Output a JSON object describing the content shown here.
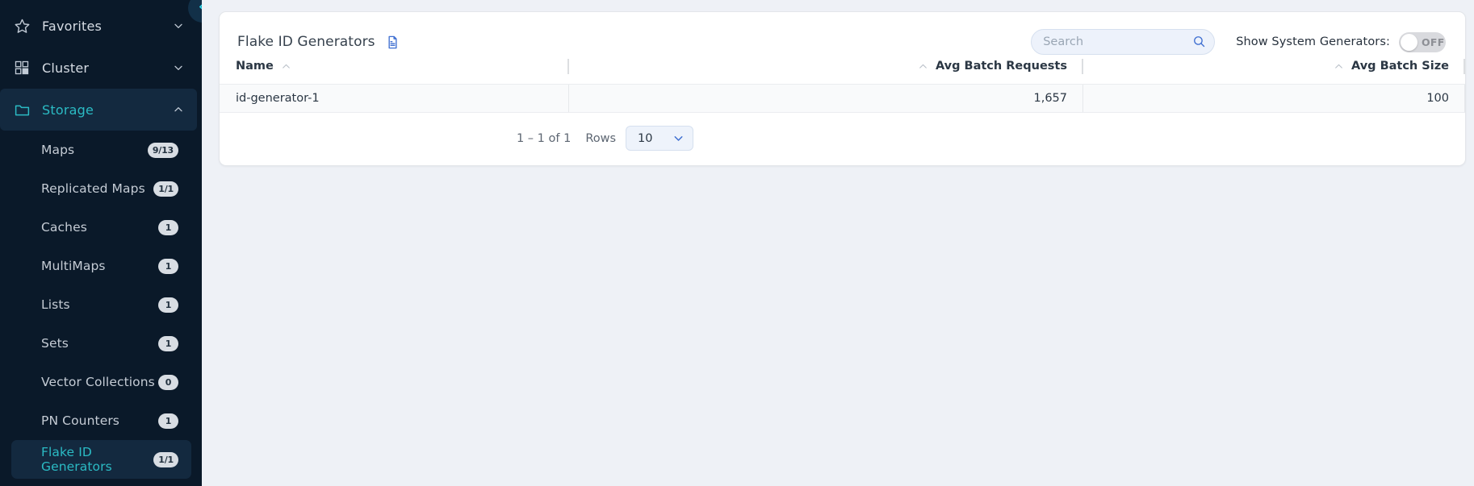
{
  "sidebar": {
    "collapse_icon": "double-chevron-left-icon",
    "groups": [
      {
        "label": "Favorites",
        "icon": "star-icon",
        "expanded": false,
        "chevron": "chevron-down-icon",
        "active": false
      },
      {
        "label": "Cluster",
        "icon": "grid-icon",
        "expanded": false,
        "chevron": "chevron-down-icon",
        "active": false
      },
      {
        "label": "Storage",
        "icon": "folder-icon",
        "expanded": true,
        "chevron": "chevron-up-icon",
        "active": true
      }
    ],
    "items": [
      {
        "label": "Maps",
        "badge": "9/13",
        "selected": false
      },
      {
        "label": "Replicated Maps",
        "badge": "1/1",
        "selected": false
      },
      {
        "label": "Caches",
        "badge": "1",
        "selected": false
      },
      {
        "label": "MultiMaps",
        "badge": "1",
        "selected": false
      },
      {
        "label": "Lists",
        "badge": "1",
        "selected": false
      },
      {
        "label": "Sets",
        "badge": "1",
        "selected": false
      },
      {
        "label": "Vector Collections",
        "badge": "0",
        "selected": false
      },
      {
        "label": "PN Counters",
        "badge": "1",
        "selected": false
      },
      {
        "label": "Flake ID Generators",
        "badge": "1/1",
        "selected": true
      }
    ]
  },
  "header": {
    "title": "Flake ID Generators",
    "doc_icon": "document-icon",
    "search": {
      "value": "",
      "placeholder": "Search",
      "icon": "search-icon"
    },
    "system_toggle": {
      "label": "Show System Generators:",
      "state": "OFF",
      "on": false
    }
  },
  "table": {
    "columns": [
      {
        "label": "Name",
        "align": "left",
        "sort": "asc",
        "sort_icon": "chevron-up-icon"
      },
      {
        "label": "Avg Batch Requests",
        "align": "right",
        "sort": "asc",
        "sort_icon": "chevron-up-icon"
      },
      {
        "label": "Avg Batch Size",
        "align": "right",
        "sort": "asc",
        "sort_icon": "chevron-up-icon"
      }
    ],
    "rows": [
      {
        "name": "id-generator-1",
        "avg_batch_requests": "1,657",
        "avg_batch_size": "100"
      }
    ]
  },
  "pagination": {
    "range": "1 – 1 of 1",
    "rows_label": "Rows",
    "rows_value": "10",
    "chevron": "chevron-down-icon"
  },
  "colors": {
    "sidebar_bg": "#0a1929",
    "sidebar_active": "#13293f",
    "accent_teal": "#2bbbc4",
    "accent_blue": "#3f6fd1",
    "page_bg": "#eef1f6",
    "card_bg": "#ffffff",
    "row_bg": "#f9fafb"
  }
}
